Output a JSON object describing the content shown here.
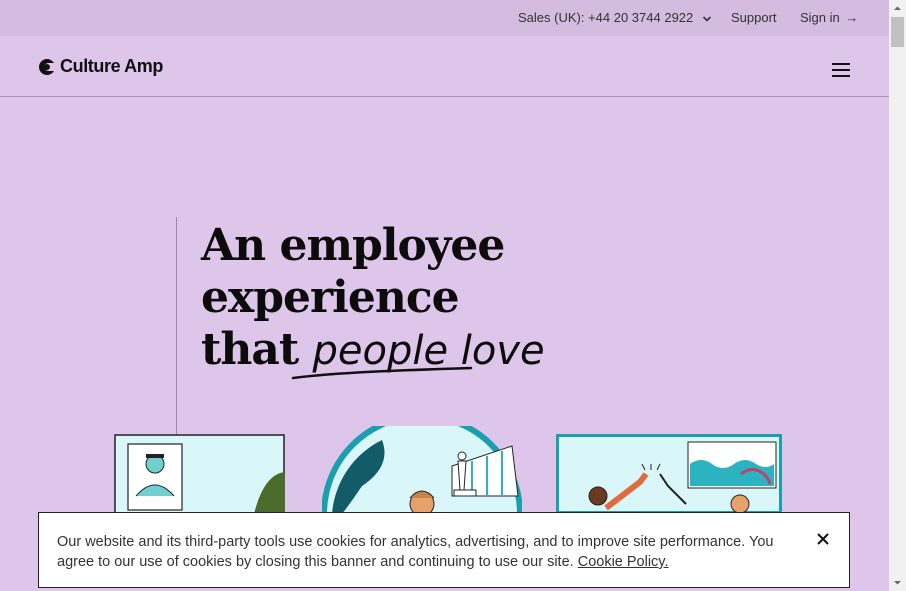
{
  "utility": {
    "sales": "Sales (UK): +44 20 3744 2922",
    "support": "Support",
    "signin": "Sign in"
  },
  "header": {
    "logo": "Culture Amp"
  },
  "hero": {
    "line1": "An employee",
    "line2": "experience",
    "line3_prefix": "that ",
    "line3_script": "people love"
  },
  "cookie": {
    "text": "Our website and its third-party tools use cookies for analytics, advertising, and to improve site performance. You agree to our use of cookies by closing this banner and continuing to use our site.",
    "link": "Cookie Policy."
  },
  "icons": {
    "chevron": "chevron-down-icon",
    "arrow": "arrow-right-icon",
    "menu": "hamburger-menu-icon",
    "close": "close-icon"
  },
  "colors": {
    "background": "#dec6eb",
    "utility_bar": "#d3bcdf",
    "teal": "#2bb3c0",
    "light_teal": "#d8f6f6"
  }
}
